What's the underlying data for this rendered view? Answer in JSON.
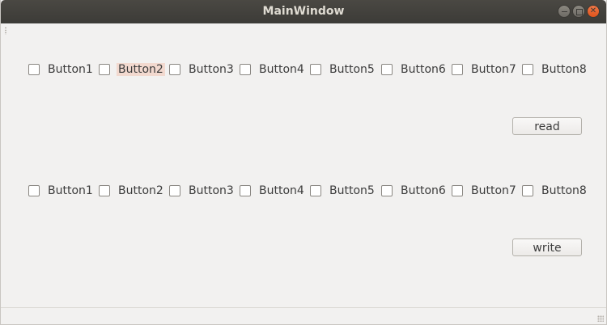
{
  "window": {
    "title": "MainWindow",
    "controls": [
      "minimize-icon",
      "maximize-icon",
      "close-icon"
    ]
  },
  "read_group": {
    "checkboxes": [
      {
        "label": "Button1",
        "checked": false
      },
      {
        "label": "Button2",
        "checked": false,
        "focused": true
      },
      {
        "label": "Button3",
        "checked": false
      },
      {
        "label": "Button4",
        "checked": false
      },
      {
        "label": "Button5",
        "checked": false
      },
      {
        "label": "Button6",
        "checked": false
      },
      {
        "label": "Button7",
        "checked": false
      },
      {
        "label": "Button8",
        "checked": false
      }
    ],
    "button_label": "read"
  },
  "write_group": {
    "checkboxes": [
      {
        "label": "Button1",
        "checked": false
      },
      {
        "label": "Button2",
        "checked": false
      },
      {
        "label": "Button3",
        "checked": false
      },
      {
        "label": "Button4",
        "checked": false
      },
      {
        "label": "Button5",
        "checked": false
      },
      {
        "label": "Button6",
        "checked": false
      },
      {
        "label": "Button7",
        "checked": false
      },
      {
        "label": "Button8",
        "checked": false
      }
    ],
    "button_label": "write"
  },
  "colors": {
    "titlebar": "#3c3b37",
    "title_text": "#dfdbd2",
    "close_button": "#e95420",
    "window_bg": "#f2f1f0",
    "focus_highlight": "#f2d9cf"
  }
}
